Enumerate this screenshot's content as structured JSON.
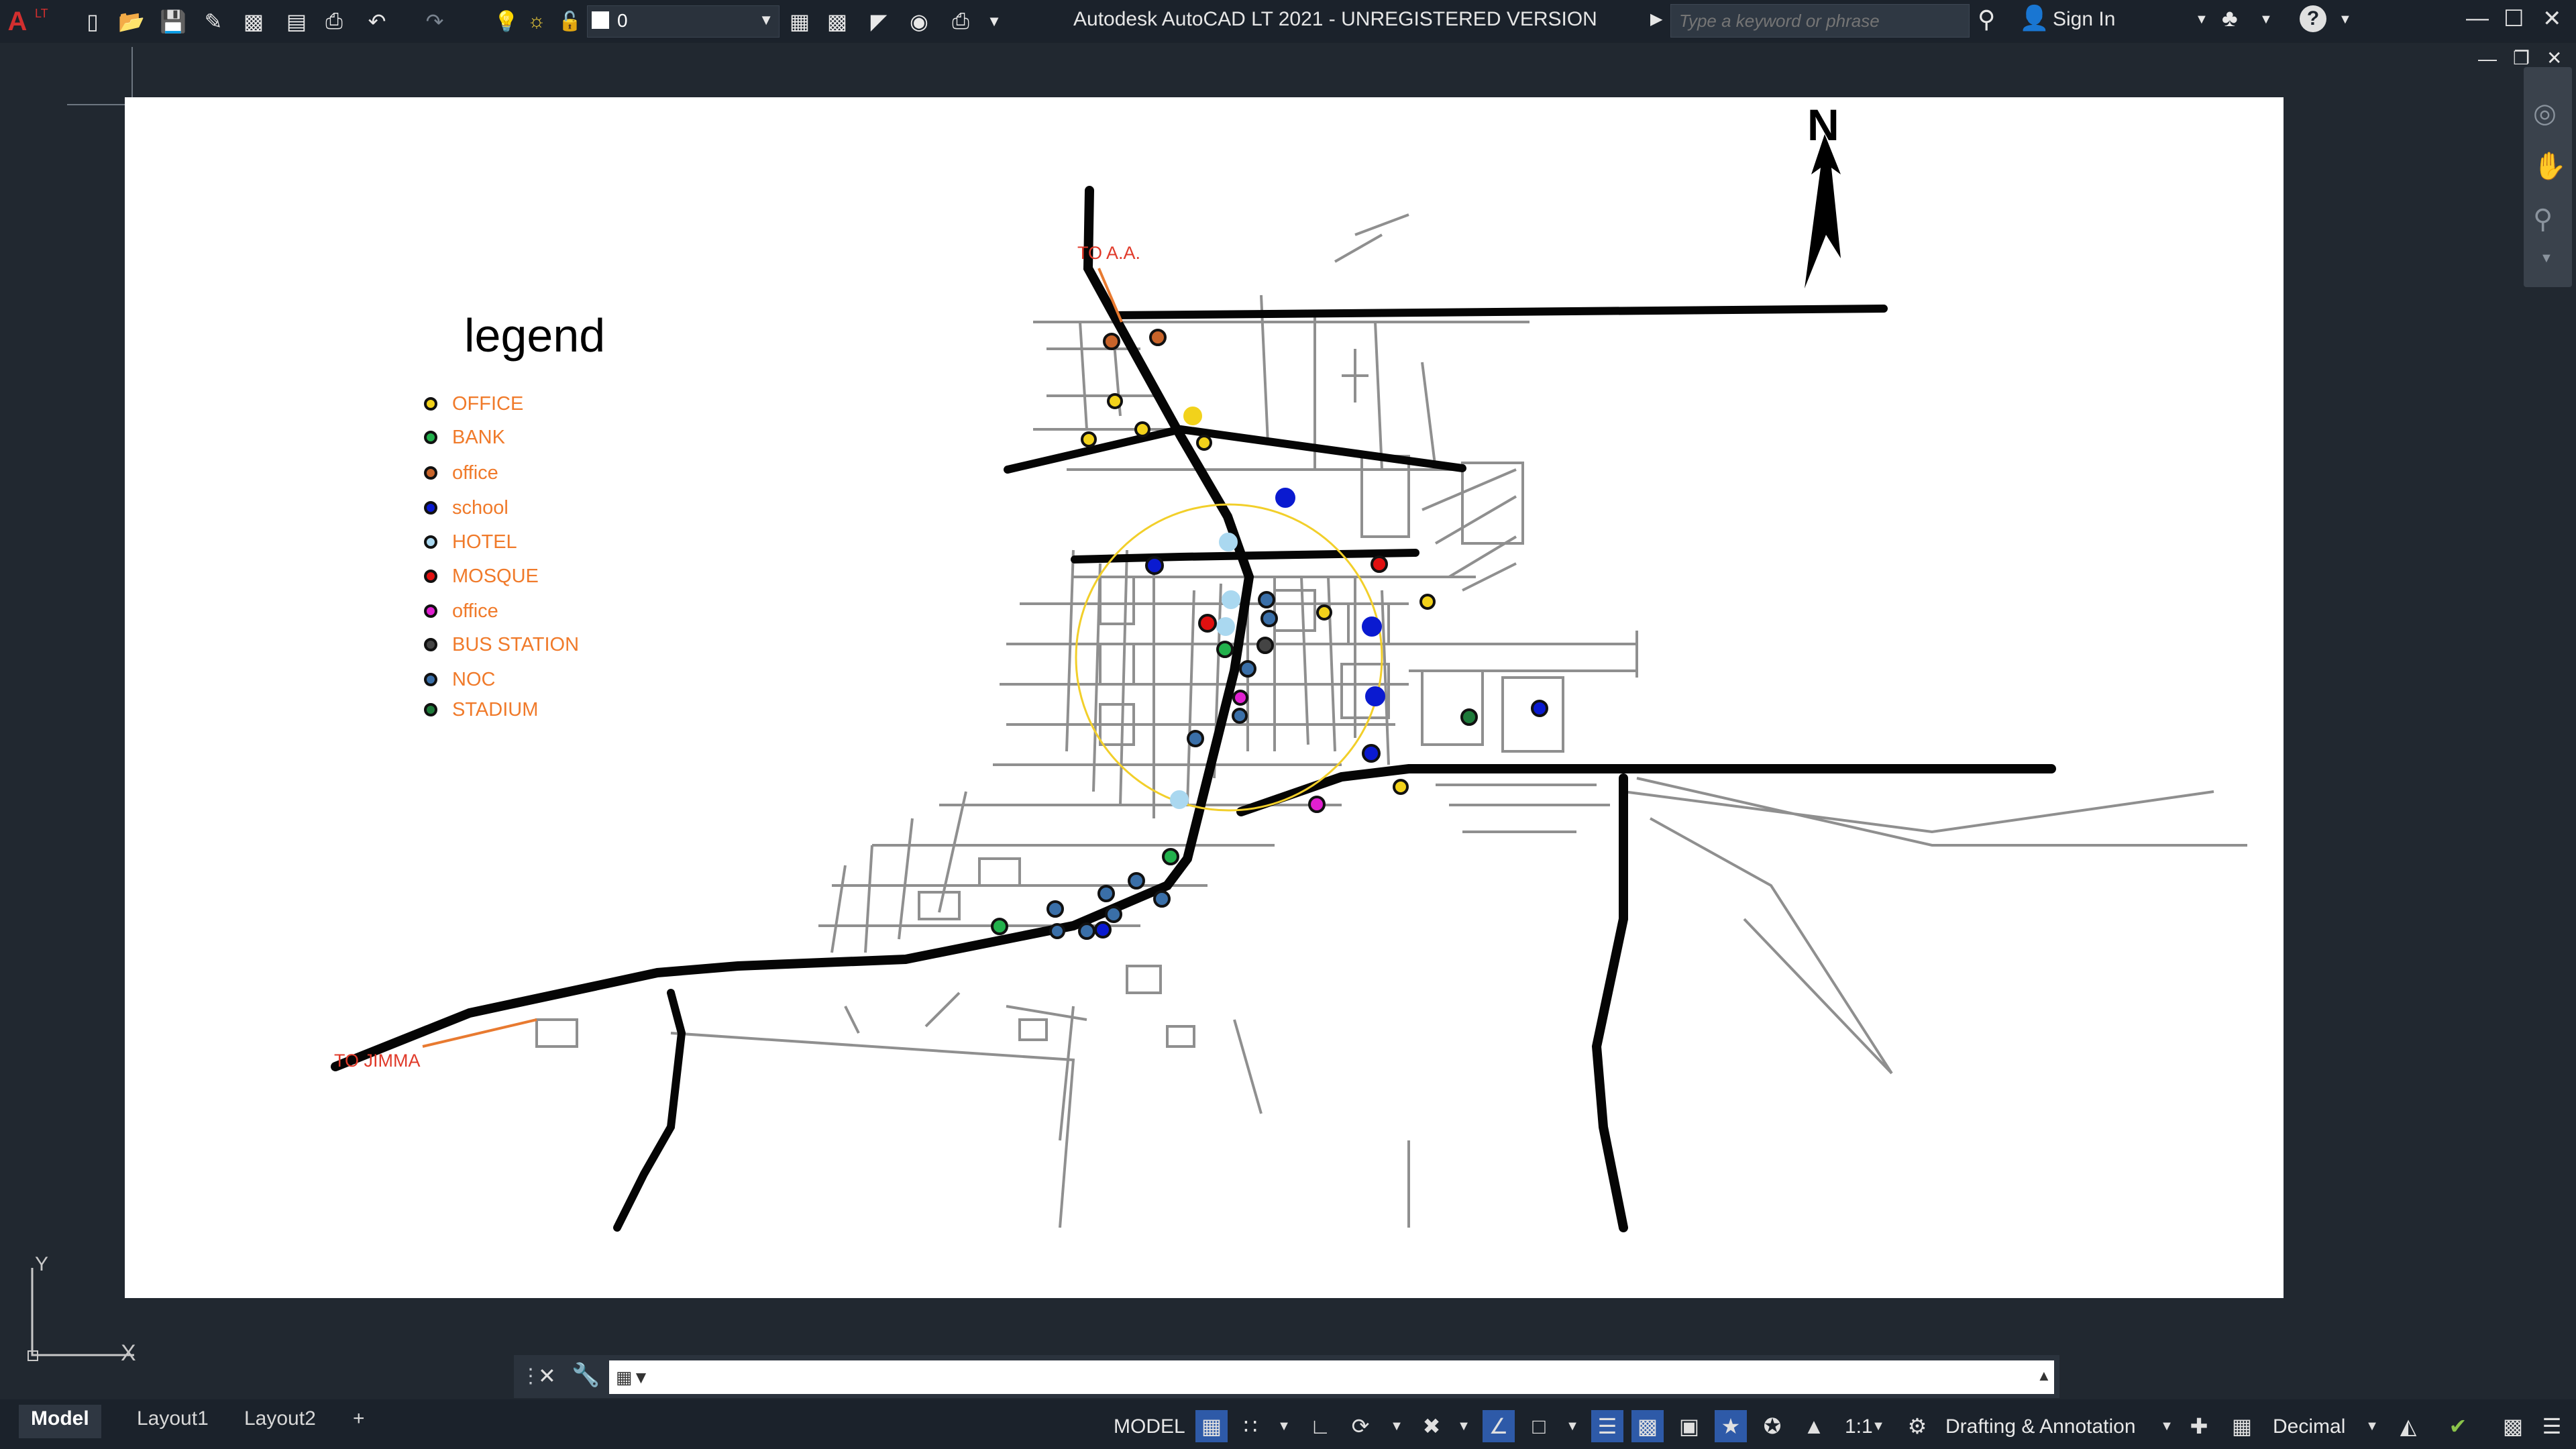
{
  "app": {
    "title": "Autodesk AutoCAD LT 2021 - UNREGISTERED VERSION",
    "logo_text": "LT"
  },
  "qat": {
    "layer_value": "0",
    "icons": [
      "new-icon",
      "open-icon",
      "save-icon",
      "save-as-icon",
      "publish-icon",
      "plot-preview-icon",
      "plot-icon",
      "undo-icon",
      "redo-icon"
    ]
  },
  "search": {
    "placeholder": "Type a keyword or phrase"
  },
  "account": {
    "sign_in": "Sign In"
  },
  "drawing": {
    "legend_title": "legend",
    "north_label": "N",
    "label_aa": "TO A.A.",
    "label_jimma": "TO JIMMA",
    "legend": [
      {
        "label": "OFFICE",
        "color": "#f2d21b"
      },
      {
        "label": "BANK",
        "color": "#22b14c"
      },
      {
        "label": "office",
        "color": "#c8642a"
      },
      {
        "label": "school",
        "color": "#0a1ad0"
      },
      {
        "label": "HOTEL",
        "color": "#aad8f0"
      },
      {
        "label": "MOSQUE",
        "color": "#e01010"
      },
      {
        "label": "office",
        "color": "#e020d0"
      },
      {
        "label": "BUS STATION",
        "color": "#444444"
      },
      {
        "label": "NOC",
        "color": "#3a6fa8"
      },
      {
        "label": "STADIUM",
        "color": "#1e7a3a"
      }
    ]
  },
  "ucs": {
    "y_label": "Y",
    "x_label": "X"
  },
  "command": {
    "value": ""
  },
  "status": {
    "tabs": [
      "Model",
      "Layout1",
      "Layout2",
      "+"
    ],
    "model_label": "MODEL",
    "scale": "1:1",
    "workspace": "Drafting & Annotation",
    "units": "Decimal"
  },
  "colors": {
    "accent": "#2e5aa8",
    "background": "#212830",
    "legend_text": "#f07a2a",
    "road_label": "#e03a2a"
  }
}
